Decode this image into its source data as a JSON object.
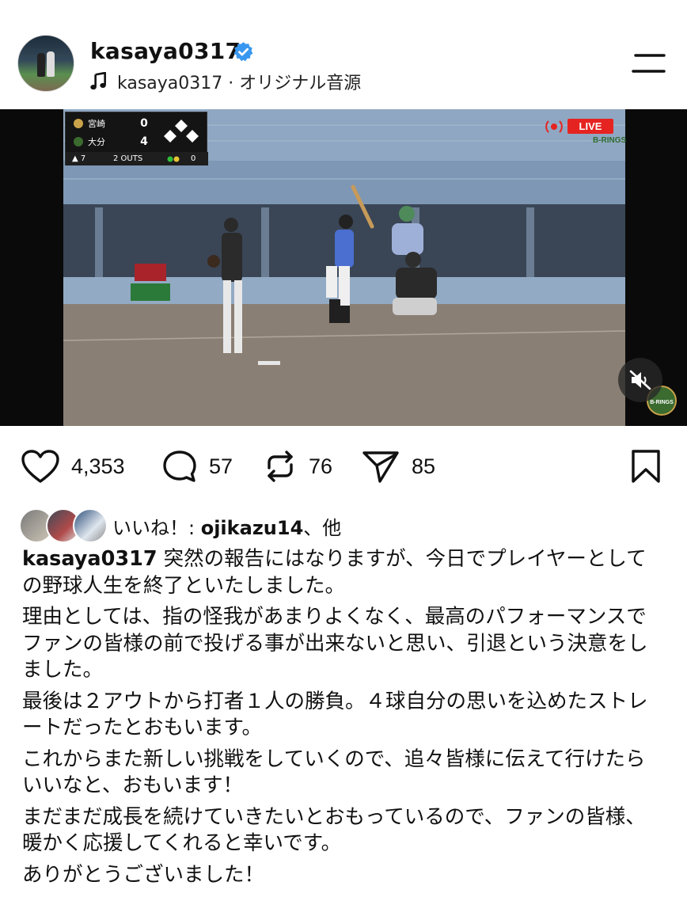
{
  "header": {
    "username": "kasaya0317",
    "audio_label": "kasaya0317 · オリジナル音源"
  },
  "video": {
    "scoreboard": {
      "team_top": "宮崎",
      "score_top": "0",
      "team_bottom": "大分",
      "score_bottom": "4",
      "inning": "▲ 7",
      "outs": "2 OUTS",
      "count": "0"
    },
    "live_label": "LIVE",
    "sponsor_text": "B-RINGS",
    "corner_logo_text": "B-RINGS"
  },
  "actions": {
    "likes": "4,353",
    "comments": "57",
    "reposts": "76",
    "shares": "85"
  },
  "liked_by": {
    "prefix": "いいね！: ",
    "user": "ojikazu14",
    "suffix": "、他"
  },
  "caption": {
    "user": "kasaya0317",
    "paragraphs": [
      " 突然の報告にはなりますが、今日でプレイヤーとしての野球人生を終了といたしました。",
      "理由としては、指の怪我があまりよくなく、最高のパフォーマンスでファンの皆様の前で投げる事が出来ないと思い、引退という決意をしました。",
      "最後は２アウトから打者１人の勝負。４球自分の思いを込めたストレートだったとおもいます。",
      "これからまた新しい挑戦をしていくので、追々皆様に伝えて行けたらいいなと、おもいます！",
      "まだまだ成長を続けていきたいとおもっているので、ファンの皆様、暖かく応援してくれると幸いです。",
      "ありがとうございました！"
    ]
  },
  "colors": {
    "verified_blue": "#3897f0",
    "live_red": "#e52421",
    "text": "#111111"
  },
  "icons": {
    "verified": "verified-badge-icon",
    "music": "music-note-icon",
    "menu": "menu-icon",
    "like": "heart-icon",
    "comment": "comment-bubble-icon",
    "repost": "repost-icon",
    "share": "paper-plane-icon",
    "save": "bookmark-icon",
    "mute": "muted-speaker-icon"
  }
}
